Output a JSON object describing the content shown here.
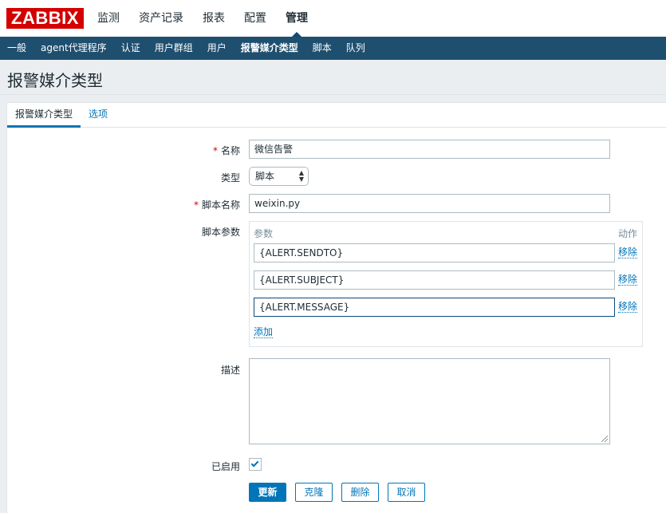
{
  "logo": "ZABBIX",
  "main_nav": [
    "监测",
    "资产记录",
    "报表",
    "配置",
    "管理"
  ],
  "sub_nav": [
    "一般",
    "agent代理程序",
    "认证",
    "用户群组",
    "用户",
    "报警媒介类型",
    "脚本",
    "队列"
  ],
  "page_title": "报警媒介类型",
  "tabs": [
    "报警媒介类型",
    "选项"
  ],
  "form": {
    "name_label": "名称",
    "name_value": "微信告警",
    "type_label": "类型",
    "type_value": "脚本",
    "script_name_label": "脚本名称",
    "script_name_value": "weixin.py",
    "script_params_label": "脚本参数",
    "params_header": "参数",
    "action_header": "动作",
    "params": [
      "{ALERT.SENDTO}",
      "{ALERT.SUBJECT}",
      "{ALERT.MESSAGE}"
    ],
    "remove_label": "移除",
    "add_label": "添加",
    "description_label": "描述",
    "description_value": "",
    "enabled_label": "已启用",
    "enabled": true
  },
  "buttons": {
    "update": "更新",
    "clone": "克隆",
    "delete": "删除",
    "cancel": "取消"
  },
  "colors": {
    "brand_red": "#d40000",
    "subnav_bg": "#1f4f6f",
    "accent_blue": "#0275b8"
  }
}
